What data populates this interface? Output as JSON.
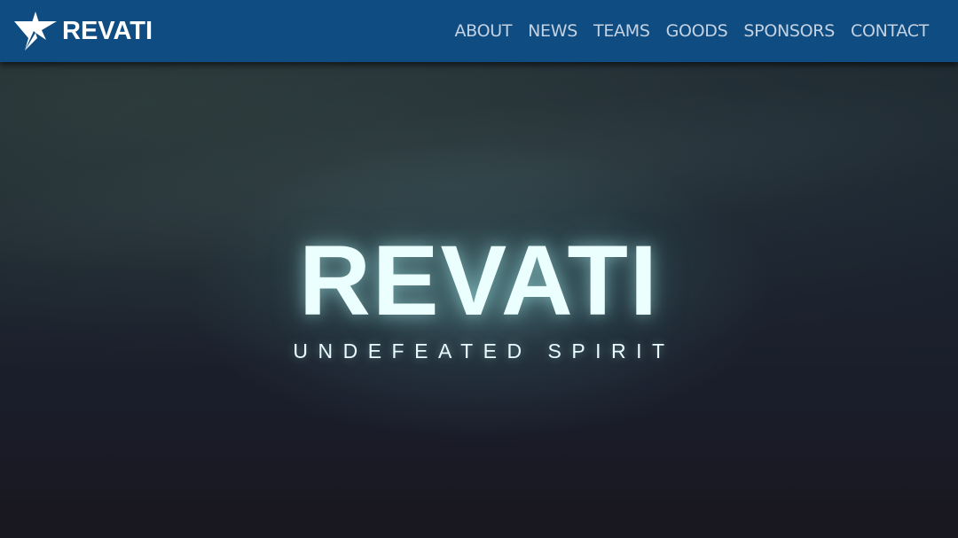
{
  "header": {
    "brand": "REVATI",
    "logo_icon": "star-icon",
    "background_color": "#0f4c81",
    "nav": [
      {
        "label": "ABOUT"
      },
      {
        "label": "NEWS"
      },
      {
        "label": "TEAMS"
      },
      {
        "label": "GOODS"
      },
      {
        "label": "SPONSORS"
      },
      {
        "label": "CONTACT"
      }
    ]
  },
  "hero": {
    "title": "REVATI",
    "subtitle": "UNDEFEATED SPIRIT",
    "text_color": "#ecffff"
  }
}
